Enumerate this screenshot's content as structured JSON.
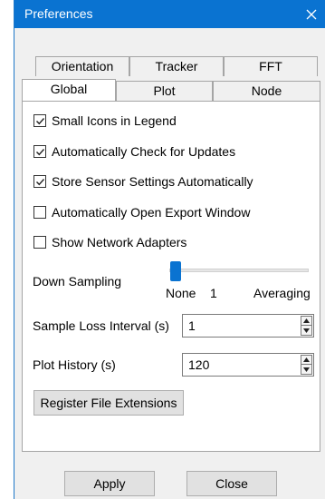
{
  "window": {
    "title": "Preferences"
  },
  "tabs": {
    "row_back": [
      "Orientation",
      "Tracker",
      "FFT"
    ],
    "row_front": [
      "Global",
      "Plot",
      "Node"
    ],
    "active": "Global"
  },
  "checkboxes": [
    {
      "label": "Small Icons in Legend",
      "checked": true
    },
    {
      "label": "Automatically Check for Updates",
      "checked": true
    },
    {
      "label": "Store Sensor Settings Automatically",
      "checked": true
    },
    {
      "label": "Automatically Open Export Window",
      "checked": false
    },
    {
      "label": "Show Network Adapters",
      "checked": false
    }
  ],
  "down_sampling": {
    "label": "Down Sampling",
    "min_label": "None",
    "value_label": "1",
    "max_label": "Averaging"
  },
  "sample_loss": {
    "label": "Sample Loss Interval (s)",
    "value": "1"
  },
  "plot_history": {
    "label": "Plot History (s)",
    "value": "120"
  },
  "register_button": "Register File Extensions",
  "buttons": {
    "apply": "Apply",
    "close": "Close"
  },
  "colors": {
    "titlebar": "#0a73d1",
    "accent": "#0a73d1"
  }
}
